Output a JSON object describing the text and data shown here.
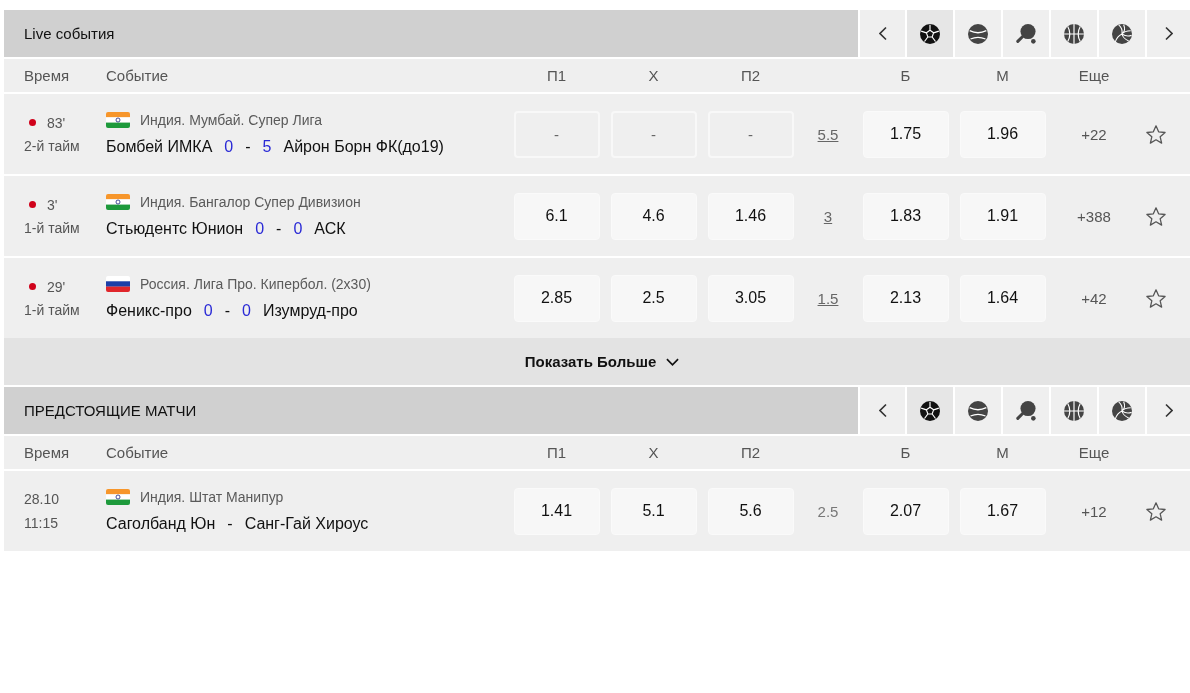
{
  "sections": [
    {
      "title": "Live события",
      "sports": [
        {
          "kind": "soccer",
          "selected": true
        },
        {
          "kind": "tennis",
          "selected": false
        },
        {
          "kind": "table_tennis",
          "selected": false
        },
        {
          "kind": "basketball",
          "selected": false
        },
        {
          "kind": "volleyball",
          "selected": false
        }
      ],
      "columns": [
        "Время",
        "Событие",
        "П1",
        "Х",
        "П2",
        "Б",
        "М",
        "Еще"
      ],
      "events": [
        {
          "kind": "live",
          "minute": "83'",
          "period": "2-й тайм",
          "flag": {
            "kind": "india"
          },
          "league": "Индия. Мумбай. Супер Лига",
          "home": "Бомбей ИМКА",
          "home_score": "0",
          "separator": "-",
          "away_score": "5",
          "away": "Айрон Борн ФК(до19)",
          "odds": [
            {
              "value": "-",
              "disabled": true
            },
            {
              "value": "-",
              "disabled": true
            },
            {
              "value": "-",
              "disabled": true
            },
            {
              "value": "1.75",
              "disabled": false
            },
            {
              "value": "1.96",
              "disabled": false
            }
          ],
          "total": {
            "value": "5.5",
            "link": true
          },
          "more": "+22",
          "favorite": false
        },
        {
          "kind": "live",
          "minute": "3'",
          "period": "1-й тайм",
          "flag": {
            "kind": "india"
          },
          "league": "Индия. Бангалор Супер Дивизион",
          "home": "Стьюдентс Юнион",
          "home_score": "0",
          "separator": "-",
          "away_score": "0",
          "away": "АСК",
          "odds": [
            {
              "value": "6.1",
              "disabled": false
            },
            {
              "value": "4.6",
              "disabled": false
            },
            {
              "value": "1.46",
              "disabled": false
            },
            {
              "value": "1.83",
              "disabled": false
            },
            {
              "value": "1.91",
              "disabled": false
            }
          ],
          "total": {
            "value": "3",
            "link": true
          },
          "more": "+388",
          "favorite": false
        },
        {
          "kind": "live",
          "minute": "29'",
          "period": "1-й тайм",
          "flag": {
            "kind": "russia"
          },
          "league": "Россия. Лига Про. Кипербол. (2x30)",
          "home": "Феникс-про",
          "home_score": "0",
          "separator": "-",
          "away_score": "0",
          "away": "Изумруд-про",
          "odds": [
            {
              "value": "2.85",
              "disabled": false
            },
            {
              "value": "2.5",
              "disabled": false
            },
            {
              "value": "3.05",
              "disabled": false
            },
            {
              "value": "2.13",
              "disabled": false
            },
            {
              "value": "1.64",
              "disabled": false
            }
          ],
          "total": {
            "value": "1.5",
            "link": true
          },
          "more": "+42",
          "favorite": false
        }
      ],
      "show_more": {
        "label": "Показать Больше"
      }
    },
    {
      "title": "ПРЕДСТОЯЩИЕ МАТЧИ",
      "sports": [
        {
          "kind": "soccer",
          "selected": true
        },
        {
          "kind": "tennis",
          "selected": false
        },
        {
          "kind": "table_tennis",
          "selected": false
        },
        {
          "kind": "basketball",
          "selected": false
        },
        {
          "kind": "volleyball",
          "selected": false
        }
      ],
      "columns": [
        "Время",
        "Событие",
        "П1",
        "Х",
        "П2",
        "Б",
        "М",
        "Еще"
      ],
      "events": [
        {
          "kind": "upcoming",
          "date": "28.10",
          "time": "11:15",
          "flag": {
            "kind": "india"
          },
          "league": "Индия. Штат Манипур",
          "home": "Саголбанд Юн",
          "separator": "-",
          "away": "Санг-Гай Хироус",
          "odds": [
            {
              "value": "1.41",
              "disabled": false
            },
            {
              "value": "5.1",
              "disabled": false
            },
            {
              "value": "5.6",
              "disabled": false
            },
            {
              "value": "2.07",
              "disabled": false
            },
            {
              "value": "1.67",
              "disabled": false
            }
          ],
          "total": {
            "value": "2.5",
            "link": false
          },
          "more": "+12",
          "favorite": false
        }
      ]
    }
  ]
}
